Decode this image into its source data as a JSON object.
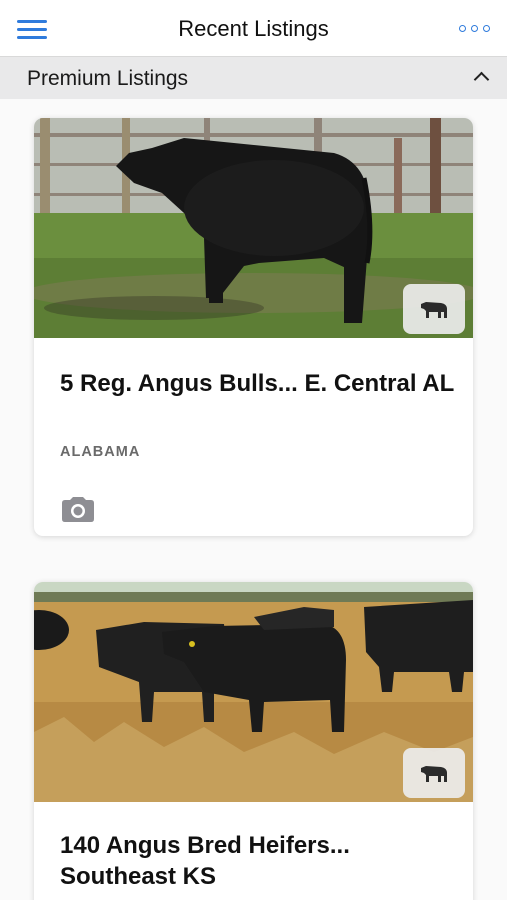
{
  "header": {
    "title": "Recent Listings",
    "menu_icon": "hamburger-menu-icon",
    "more_icon": "more-options-icon",
    "accent_color": "#2f7bdc"
  },
  "section": {
    "title": "Premium Listings",
    "toggle_icon": "chevron-up-icon",
    "background": "#e9e9ea"
  },
  "listings": [
    {
      "title": "5 Reg. Angus Bulls... E. Central AL",
      "location": "ALABAMA",
      "photo_icon": "cattle-icon",
      "media_icon": "camera-icon"
    },
    {
      "title": "140 Angus Bred Heifers... Southeast KS",
      "photo_icon": "cattle-icon"
    }
  ]
}
